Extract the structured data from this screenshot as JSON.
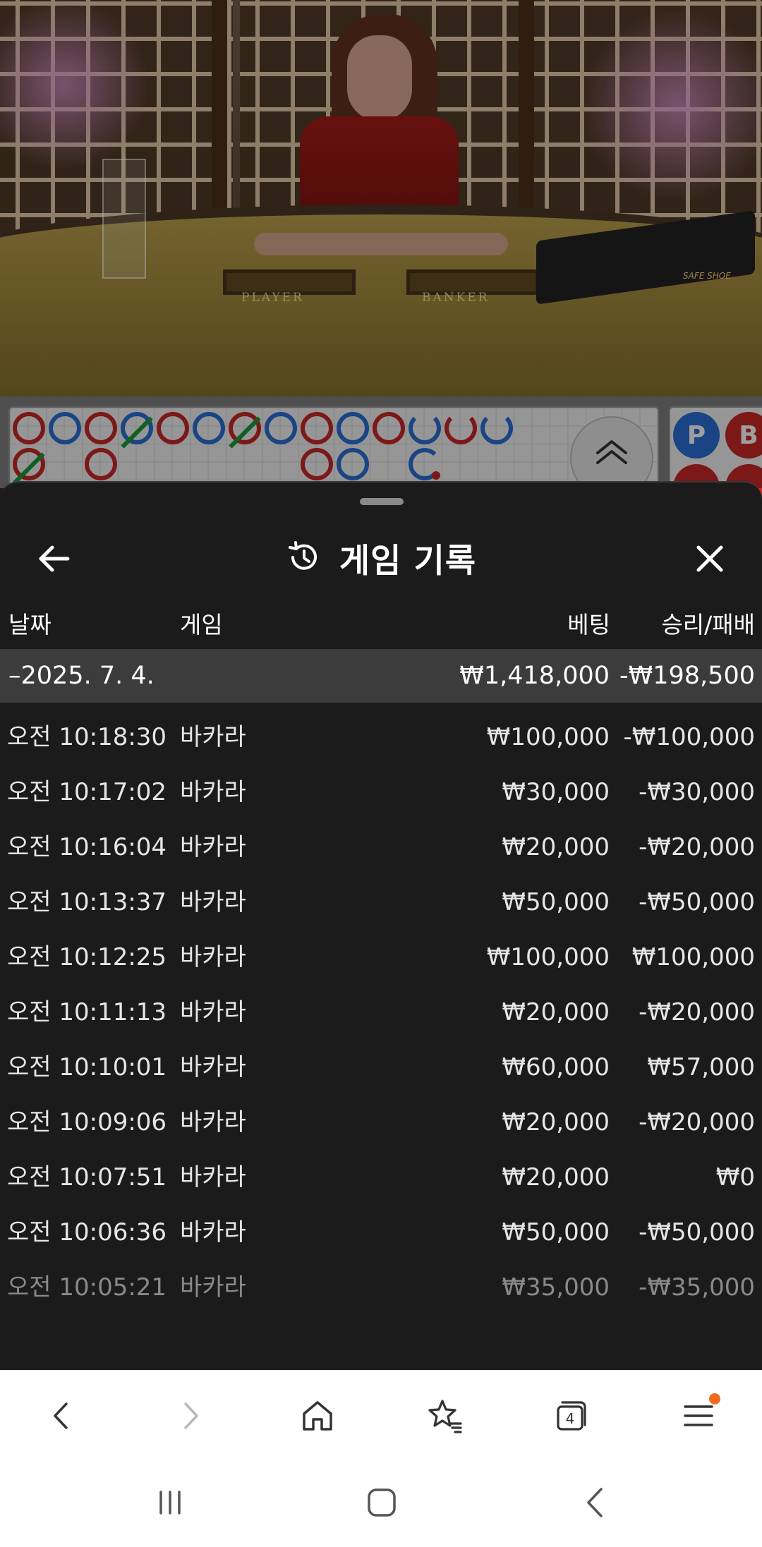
{
  "video": {
    "player_label": "PLAYER",
    "banker_label": "BANKER",
    "shoe_label": "SAFE SHOE"
  },
  "road": {
    "bead_road_labels": [
      "P",
      "B"
    ]
  },
  "sheet": {
    "title": "게임 기록",
    "columns": {
      "date": "날짜",
      "game": "게임",
      "bet": "베팅",
      "win_loss": "승리/패배"
    },
    "summary": {
      "date": "–2025. 7. 4.",
      "bet": "₩1,418,000",
      "win_loss": "-₩198,500"
    },
    "rows": [
      {
        "time": "오전 10:18:30",
        "game": "바카라",
        "bet": "₩100,000",
        "win_loss": "-₩100,000"
      },
      {
        "time": "오전 10:17:02",
        "game": "바카라",
        "bet": "₩30,000",
        "win_loss": "-₩30,000"
      },
      {
        "time": "오전 10:16:04",
        "game": "바카라",
        "bet": "₩20,000",
        "win_loss": "-₩20,000"
      },
      {
        "time": "오전 10:13:37",
        "game": "바카라",
        "bet": "₩50,000",
        "win_loss": "-₩50,000"
      },
      {
        "time": "오전 10:12:25",
        "game": "바카라",
        "bet": "₩100,000",
        "win_loss": "₩100,000"
      },
      {
        "time": "오전 10:11:13",
        "game": "바카라",
        "bet": "₩20,000",
        "win_loss": "-₩20,000"
      },
      {
        "time": "오전 10:10:01",
        "game": "바카라",
        "bet": "₩60,000",
        "win_loss": "₩57,000"
      },
      {
        "time": "오전 10:09:06",
        "game": "바카라",
        "bet": "₩20,000",
        "win_loss": "-₩20,000"
      },
      {
        "time": "오전 10:07:51",
        "game": "바카라",
        "bet": "₩20,000",
        "win_loss": "₩0"
      },
      {
        "time": "오전 10:06:36",
        "game": "바카라",
        "bet": "₩50,000",
        "win_loss": "-₩50,000"
      },
      {
        "time": "오전 10:05:21",
        "game": "바카라",
        "bet": "₩35,000",
        "win_loss": "-₩35,000"
      }
    ]
  },
  "browser_toolbar": {
    "tab_count": "4",
    "icons": [
      "back-icon",
      "forward-icon",
      "home-icon",
      "bookmarks-icon",
      "tabs-icon",
      "menu-icon"
    ],
    "menu_badge_color": "#f06a1f"
  },
  "android_nav": {
    "icons": [
      "recent-apps-icon",
      "home-icon",
      "back-icon"
    ]
  }
}
